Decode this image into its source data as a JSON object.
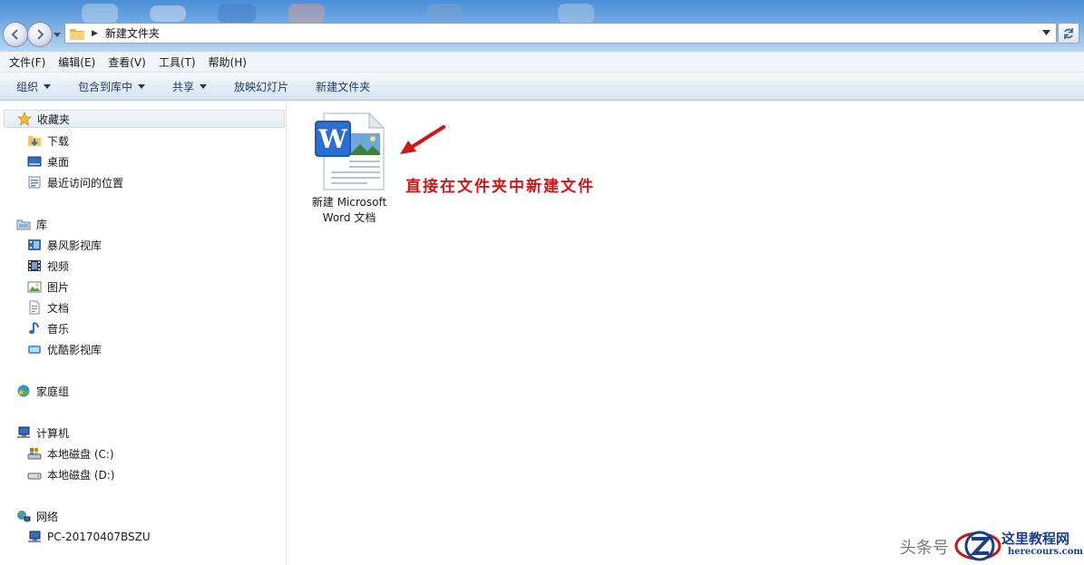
{
  "window": {
    "address_path": "新建文件夹",
    "colors": {
      "accent": "#4a8ed8",
      "annotation": "#d01616"
    }
  },
  "menu": [
    "文件(F)",
    "编辑(E)",
    "查看(V)",
    "工具(T)",
    "帮助(H)"
  ],
  "toolbar": {
    "organize": "组织",
    "include_in_library": "包含到库中",
    "share": "共享",
    "slideshow": "放映幻灯片",
    "new_folder": "新建文件夹"
  },
  "sidebar": {
    "favorites": {
      "label": "收藏夹",
      "icon": "star-icon",
      "items": [
        "下载",
        "桌面",
        "最近访问的位置"
      ]
    },
    "libraries": {
      "label": "库",
      "icon": "library-icon",
      "items": [
        "暴风影视库",
        "视频",
        "图片",
        "文档",
        "音乐",
        "优酷影视库"
      ]
    },
    "homegroup": {
      "label": "家庭组",
      "icon": "homegroup-icon"
    },
    "computer": {
      "label": "计算机",
      "icon": "computer-icon",
      "items": [
        "本地磁盘 (C:)",
        "本地磁盘 (D:)"
      ]
    },
    "network": {
      "label": "网络",
      "icon": "network-icon",
      "items": [
        "PC-20170407BSZU"
      ]
    }
  },
  "content": {
    "file": {
      "line1": "新建 Microsoft",
      "line2": "Word 文档",
      "icon": "word-document-icon"
    },
    "annotation": "直接在文件夹中新建文件"
  },
  "watermark": {
    "toutiao": "头条号",
    "site_name": "这里教程网",
    "site_url": "herecours.com"
  }
}
